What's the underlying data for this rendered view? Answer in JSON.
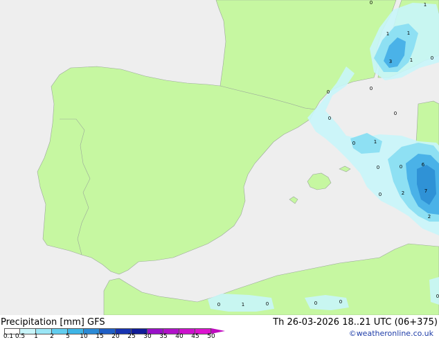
{
  "map": {
    "colors": {
      "sea": "#eeeeee",
      "land": "#c6f7a1",
      "outside": "#e2e2e2",
      "precip_light": "#c8f5fa",
      "precip_mid": "#8ee0f3",
      "precip_heavy": "#4ab2e8",
      "precip_core": "#2f92d6"
    },
    "labels": [
      "1",
      "1",
      "1",
      "3",
      "1",
      "0",
      "0",
      "0",
      "0",
      "0",
      "1",
      "0",
      "0",
      "0",
      "6",
      "0",
      "2",
      "7",
      "2",
      "0",
      "0",
      "1",
      "0",
      "0",
      "0",
      "0"
    ]
  },
  "legend": {
    "title": "Precipitation [mm] GFS",
    "datetime": "Th 26-03-2026 18..21 UTC (06+375)",
    "credit": "©weatheronline.co.uk",
    "scale_ticks": [
      "0.1",
      "0.5",
      "1",
      "2",
      "5",
      "10",
      "15",
      "20",
      "25",
      "30",
      "35",
      "40",
      "45",
      "50"
    ],
    "scale_colors": [
      "#ffffff",
      "#c8f5fa",
      "#9be6f6",
      "#61cdef",
      "#3eb5e6",
      "#2b8ad6",
      "#1f5fc6",
      "#1733b0",
      "#101c98",
      "#9810c8",
      "#b012c9",
      "#cc12cc",
      "#dd14d0"
    ],
    "arrow_color": "#c00ac0"
  }
}
